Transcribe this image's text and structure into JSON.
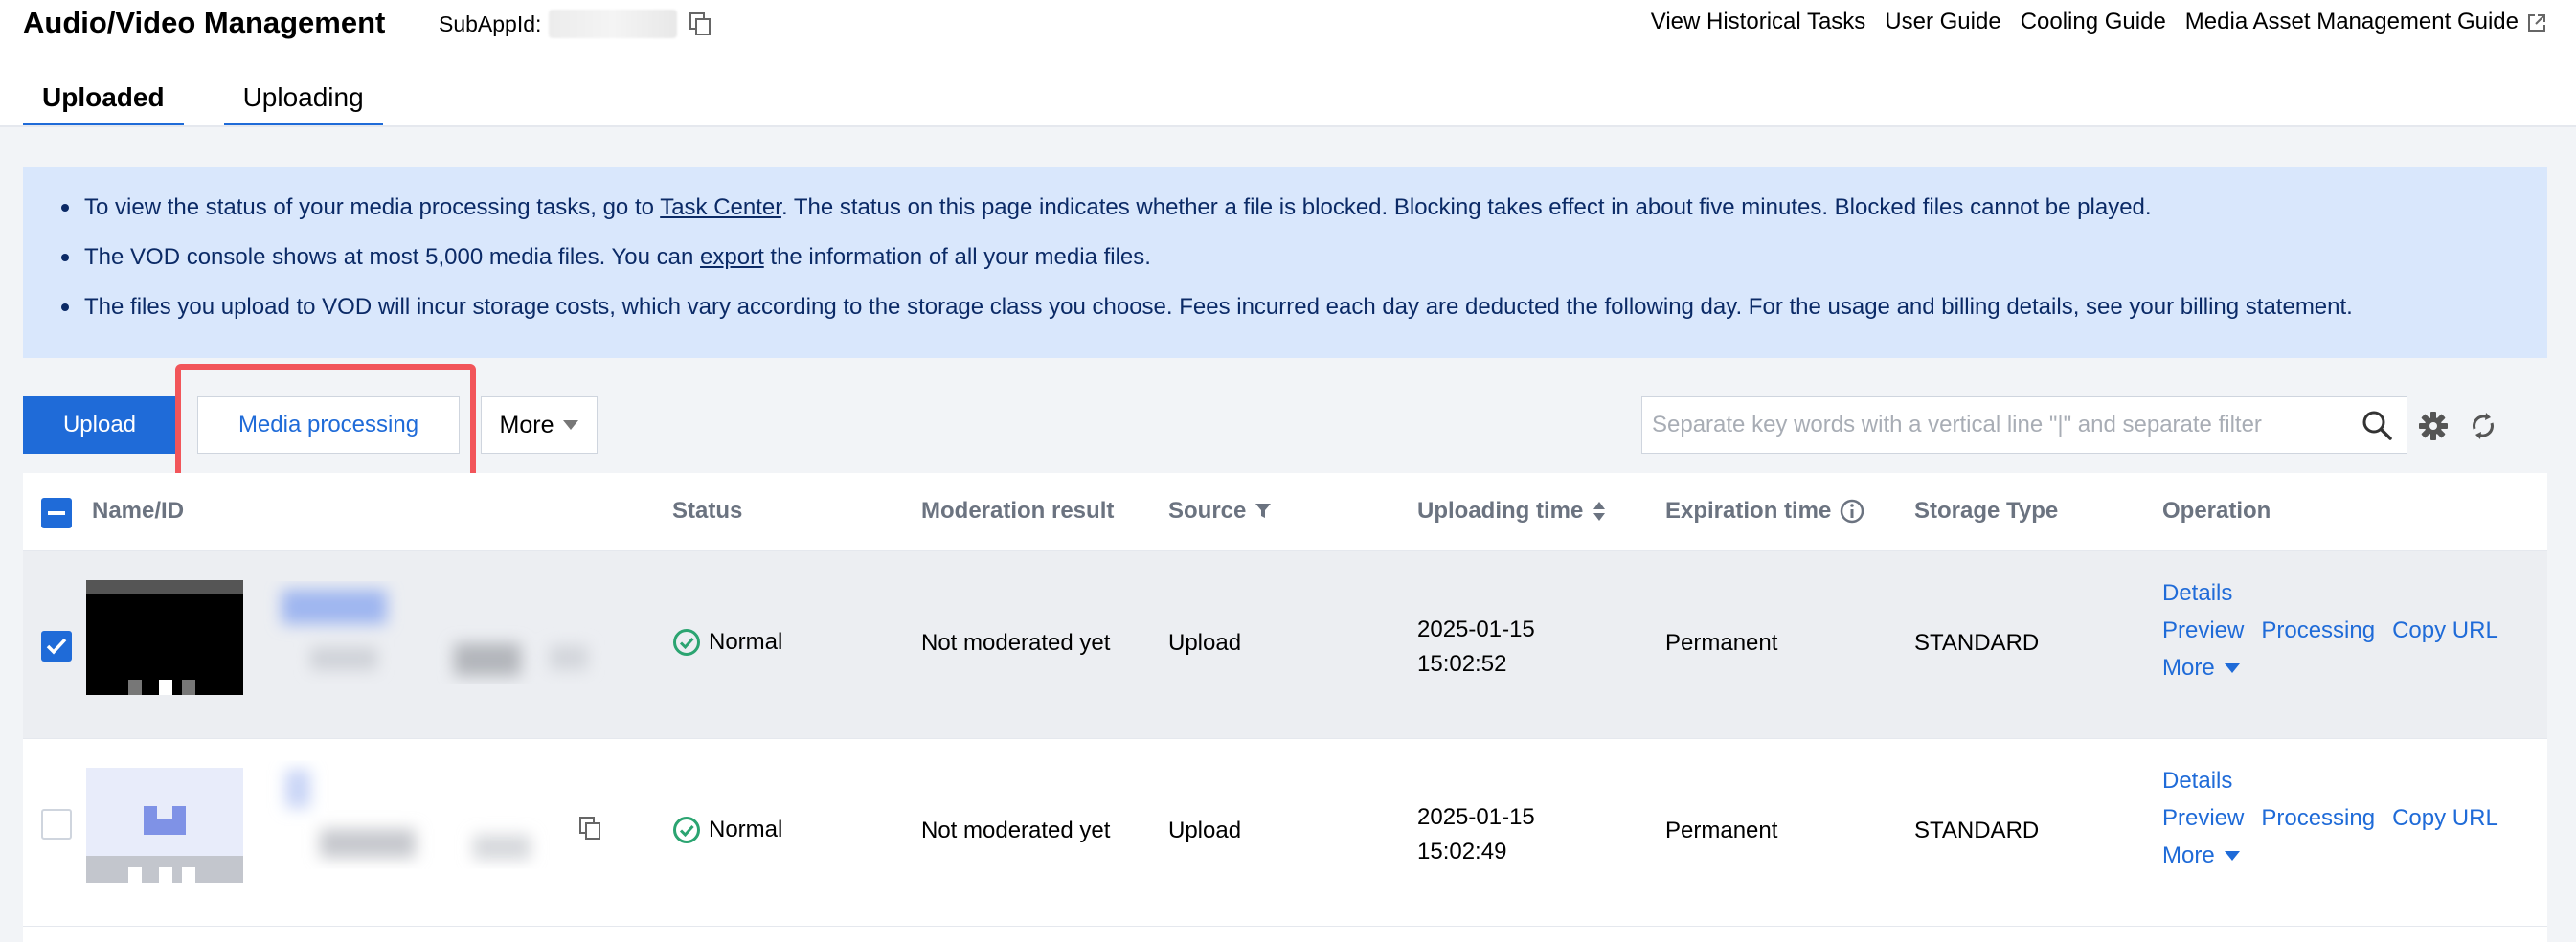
{
  "header": {
    "title": "Audio/Video Management",
    "subapp_label": "SubAppId:",
    "links": [
      "View Historical Tasks",
      "User Guide",
      "Cooling Guide",
      "Media Asset Management Guide"
    ]
  },
  "tabs": [
    {
      "label": "Uploaded",
      "active": true
    },
    {
      "label": "Uploading",
      "active": false
    }
  ],
  "notice": {
    "line1_pre": "To view the status of your media processing tasks, go to ",
    "line1_link": "Task Center",
    "line1_post": ". The status on this page indicates whether a file is blocked. Blocking takes effect in about five minutes. Blocked files cannot be played.",
    "line2_pre": "The VOD console shows at most 5,000 media files. You can ",
    "line2_link": "export",
    "line2_post": " the information of all your media files.",
    "line3": "The files you upload to VOD will incur storage costs, which vary according to the storage class you choose. Fees incurred each day are deducted the following day. For the usage and billing details, see your billing statement."
  },
  "toolbar": {
    "upload_label": "Upload",
    "media_processing_label": "Media processing",
    "more_label": "More",
    "search_placeholder": "Separate key words with a vertical line \"|\" and separate filter"
  },
  "table": {
    "columns": {
      "name": "Name/ID",
      "status": "Status",
      "moderation": "Moderation result",
      "source": "Source",
      "uploading_time": "Uploading time",
      "expiration": "Expiration time",
      "storage": "Storage Type",
      "operation": "Operation"
    },
    "rows": [
      {
        "selected": true,
        "status": "Normal",
        "moderation": "Not moderated yet",
        "source": "Upload",
        "date": "2025-01-15",
        "time": "15:02:52",
        "expiration": "Permanent",
        "storage": "STANDARD"
      },
      {
        "selected": false,
        "status": "Normal",
        "moderation": "Not moderated yet",
        "source": "Upload",
        "date": "2025-01-15",
        "time": "15:02:49",
        "expiration": "Permanent",
        "storage": "STANDARD"
      }
    ],
    "operations": {
      "details": "Details",
      "preview": "Preview",
      "processing": "Processing",
      "copy_url": "Copy URL",
      "more": "More"
    }
  },
  "colors": {
    "accent": "#1f6bd8",
    "notice_bg": "#d9e7fc",
    "highlight": "#f2555a",
    "status_ok": "#2ba471"
  }
}
